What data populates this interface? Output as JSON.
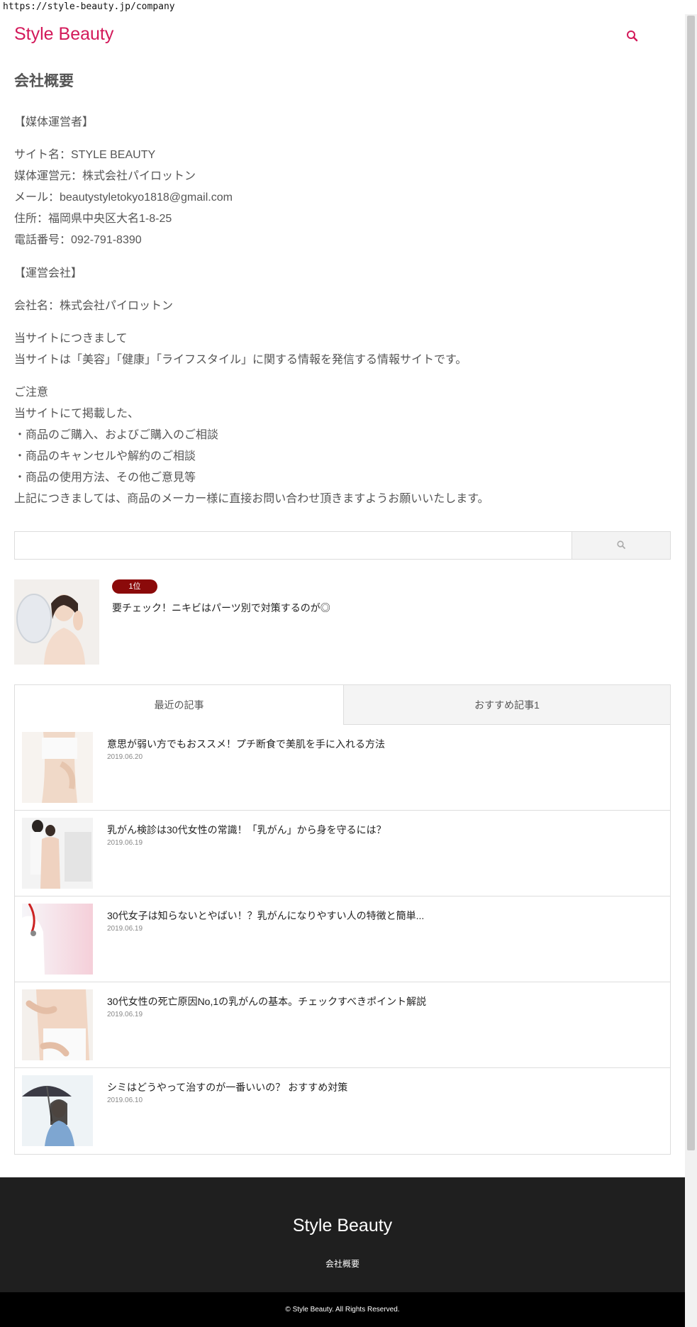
{
  "browser": {
    "url": "https://style-beauty.jp/company"
  },
  "header": {
    "logo": "Style Beauty",
    "search_icon": "search-icon"
  },
  "page": {
    "title": "会社概要",
    "operator_heading": "【媒体運営者】",
    "site_name": "サイト名：STYLE BEAUTY",
    "operator": "媒体運営元：株式会社パイロットン",
    "email": "メール：beautystyletokyo1818@gmail.com",
    "address": "住所：福岡県中央区大名1-8-25",
    "phone": "電話番号：092-791-8390",
    "company_heading": "【運営会社】",
    "company_name": "会社名：株式会社パイロットン",
    "about_heading": "当サイトにつきまして",
    "about_text": "当サイトは「美容」「健康」「ライフスタイル」に関する情報を発信する情報サイトです。",
    "notice_heading": "ご注意",
    "notice_intro": "当サイトにて掲載した、",
    "notice_items": [
      "・商品のご購入、およびご購入のご相談",
      "・商品のキャンセルや解約のご相談",
      "・商品の使用方法、その他ご意見等"
    ],
    "notice_outro": "上記につきましては、商品のメーカー様に直接お問い合わせ頂きますようお願いいたします。"
  },
  "search": {
    "placeholder": "",
    "button_icon": "search-icon"
  },
  "ranking": {
    "badge": "1位",
    "title": "要チェック！ニキビはパーツ別で対策するのが◎"
  },
  "tabs": [
    {
      "label": "最近の記事",
      "active": true
    },
    {
      "label": "おすすめ記事1",
      "active": false
    }
  ],
  "posts": [
    {
      "title": "意思が弱い方でもおススメ！プチ断食で美肌を手に入れる方法",
      "date": "2019.06.20"
    },
    {
      "title": "乳がん検診は30代女性の常識！「乳がん」から身を守るには？",
      "date": "2019.06.19"
    },
    {
      "title": "30代女子は知らないとやばい！？乳がんになりやすい人の特徴と簡単...",
      "date": "2019.06.19"
    },
    {
      "title": "30代女性の死亡原因No,1の乳がんの基本。チェックすべきポイント解説",
      "date": "2019.06.19"
    },
    {
      "title": "シミはどうやって治すのが一番いいの？ おすすめ対策",
      "date": "2019.06.10"
    }
  ],
  "footer": {
    "logo": "Style Beauty",
    "link": "会社概要",
    "copyright": "© Style Beauty. All Rights Reserved."
  },
  "colors": {
    "brand": "#d3195a",
    "badge": "#8b0a0a",
    "footer_bg": "#1f1f1f"
  }
}
